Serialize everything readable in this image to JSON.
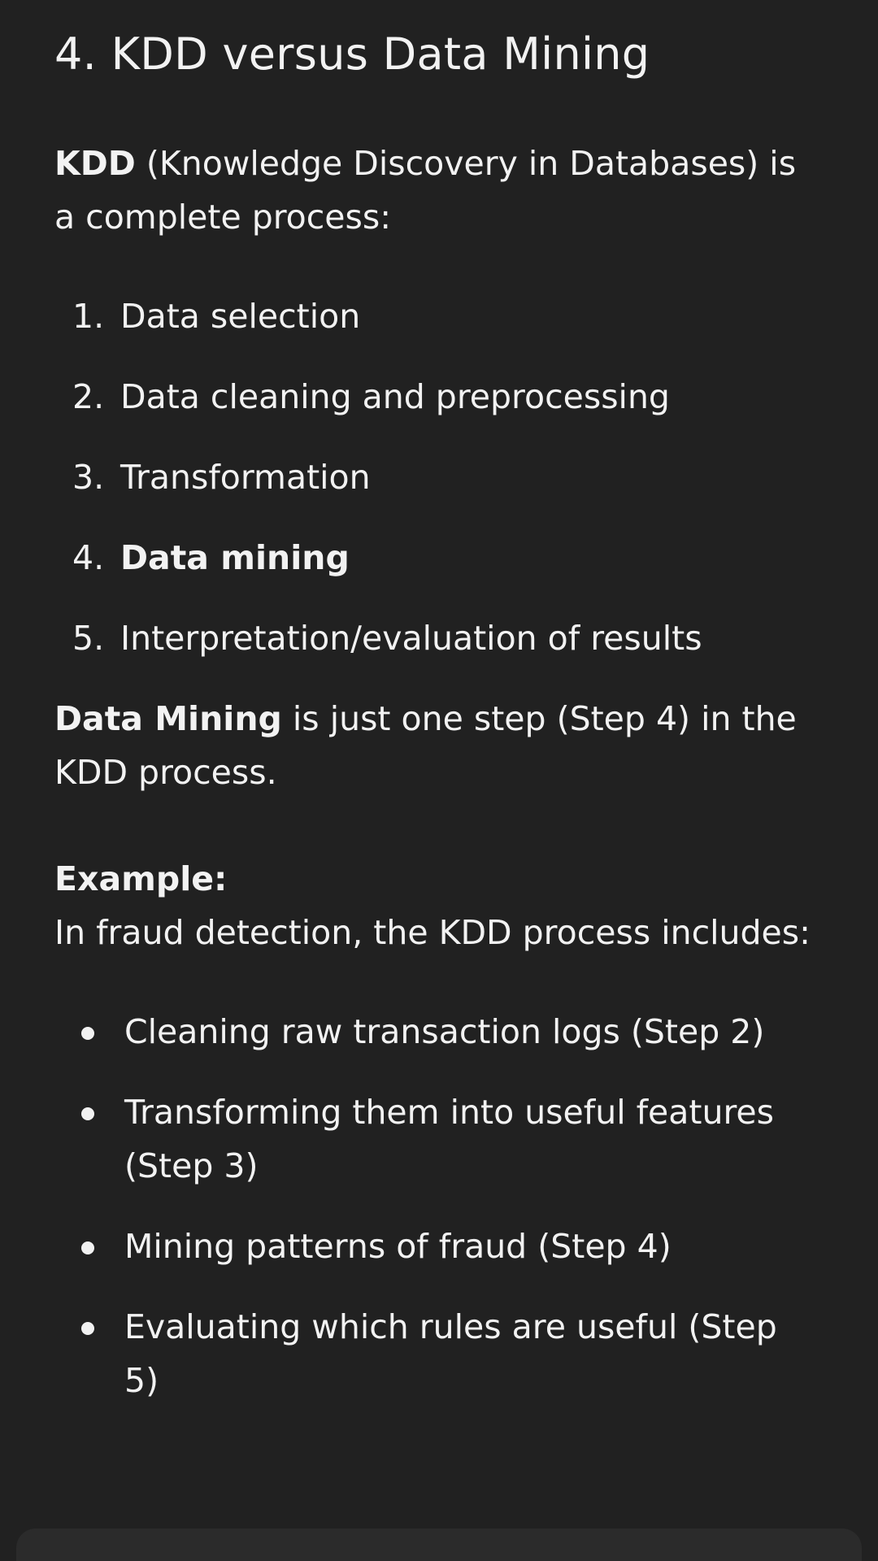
{
  "heading": "4. KDD versus Data Mining",
  "intro": {
    "term": "KDD",
    "text": " (Knowledge Discovery in Databases) is a complete process:"
  },
  "steps": [
    {
      "num": "1.",
      "label": "Data selection"
    },
    {
      "num": "2.",
      "label": "Data cleaning and preprocessing"
    },
    {
      "num": "3.",
      "label": "Transformation"
    },
    {
      "num": "4.",
      "label": "Data mining"
    },
    {
      "num": "5.",
      "label": "Interpretation/evaluation of results"
    }
  ],
  "data_mining_note": {
    "term": "Data Mining",
    "text": " is just one step (Step 4) in the KDD process."
  },
  "example": {
    "label": "Example:",
    "text": "In fraud detection, the KDD process includes:"
  },
  "example_items": [
    "Cleaning raw transaction logs (Step 2)",
    "Transforming them into useful features (Step 3)",
    "Mining patterns of fraud (Step 4)",
    "Evaluating which rules are useful (Step 5)"
  ]
}
